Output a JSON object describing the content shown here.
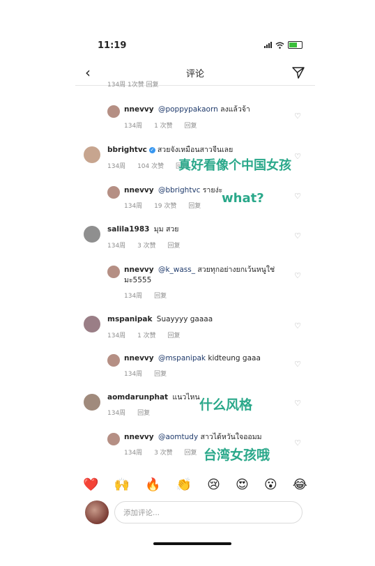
{
  "status": {
    "time": "11:19"
  },
  "nav": {
    "title": "评论"
  },
  "truncated_row": "134周  1次赞  回复",
  "comments": [
    {
      "user": "nnevvy",
      "mention": "@poppypakaorn",
      "text": "ลงแล้วจ้า",
      "age": "134周",
      "likes": "1 次赞",
      "reply": "回复"
    },
    {
      "user": "bbrightvc",
      "text": "สวยจังเหมือนสาวจีนเลย",
      "age": "134周",
      "likes": "104 次赞",
      "reply": "回复"
    },
    {
      "user": "nnevvy",
      "mention": "@bbrightvc",
      "text": "รายง่ะ",
      "age": "134周",
      "likes": "19 次赞",
      "reply": "回复"
    },
    {
      "user": "salila1983",
      "text": "มุม สวย",
      "age": "134周",
      "likes": "3 次赞",
      "reply": "回复"
    },
    {
      "user": "nnevvy",
      "mention": "@k_wass_",
      "text": "สวยทุกอย่างยกเว้นหนูใช่",
      "text2": "มะ5555",
      "age": "134周",
      "reply": "回复"
    },
    {
      "user": "mspanipak",
      "text": "Suayyyy gaaaa",
      "age": "134周",
      "likes": "1 次赞",
      "reply": "回复"
    },
    {
      "user": "nnevvy",
      "mention": "@mspanipak",
      "text": "kidteung gaaa",
      "age": "134周",
      "reply": "回复"
    },
    {
      "user": "aomdarunphat",
      "text": "แนวไหน",
      "age": "134周",
      "reply": "回复"
    },
    {
      "user": "nnevvy",
      "mention": "@aomtudy",
      "text": "สาวได้หวันใจออมม",
      "age": "134周",
      "likes": "3 次赞",
      "reply": "回复"
    }
  ],
  "overlays": {
    "o1": "真好看像个中国女孩",
    "o2": "what?",
    "o3": "什么风格",
    "o4": "台湾女孩哦"
  },
  "emojis": [
    "❤️",
    "🙌",
    "🔥",
    "👏",
    "😢",
    "😍",
    "😮",
    "😂"
  ],
  "composer": {
    "placeholder": "添加评论..."
  },
  "colors": {
    "overlay_text": "#2aa88a",
    "mention": "#1f3a6b"
  }
}
